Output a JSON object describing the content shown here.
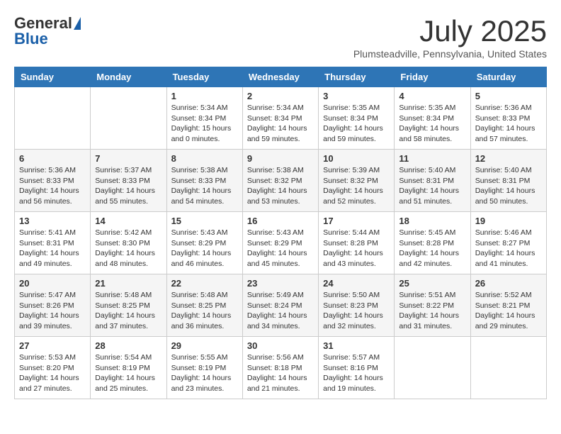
{
  "header": {
    "logo_general": "General",
    "logo_blue": "Blue",
    "month_title": "July 2025",
    "location": "Plumsteadville, Pennsylvania, United States"
  },
  "days_of_week": [
    "Sunday",
    "Monday",
    "Tuesday",
    "Wednesday",
    "Thursday",
    "Friday",
    "Saturday"
  ],
  "weeks": [
    [
      {
        "day": "",
        "info": ""
      },
      {
        "day": "",
        "info": ""
      },
      {
        "day": "1",
        "info": "Sunrise: 5:34 AM\nSunset: 8:34 PM\nDaylight: 15 hours\nand 0 minutes."
      },
      {
        "day": "2",
        "info": "Sunrise: 5:34 AM\nSunset: 8:34 PM\nDaylight: 14 hours\nand 59 minutes."
      },
      {
        "day": "3",
        "info": "Sunrise: 5:35 AM\nSunset: 8:34 PM\nDaylight: 14 hours\nand 59 minutes."
      },
      {
        "day": "4",
        "info": "Sunrise: 5:35 AM\nSunset: 8:34 PM\nDaylight: 14 hours\nand 58 minutes."
      },
      {
        "day": "5",
        "info": "Sunrise: 5:36 AM\nSunset: 8:33 PM\nDaylight: 14 hours\nand 57 minutes."
      }
    ],
    [
      {
        "day": "6",
        "info": "Sunrise: 5:36 AM\nSunset: 8:33 PM\nDaylight: 14 hours\nand 56 minutes."
      },
      {
        "day": "7",
        "info": "Sunrise: 5:37 AM\nSunset: 8:33 PM\nDaylight: 14 hours\nand 55 minutes."
      },
      {
        "day": "8",
        "info": "Sunrise: 5:38 AM\nSunset: 8:33 PM\nDaylight: 14 hours\nand 54 minutes."
      },
      {
        "day": "9",
        "info": "Sunrise: 5:38 AM\nSunset: 8:32 PM\nDaylight: 14 hours\nand 53 minutes."
      },
      {
        "day": "10",
        "info": "Sunrise: 5:39 AM\nSunset: 8:32 PM\nDaylight: 14 hours\nand 52 minutes."
      },
      {
        "day": "11",
        "info": "Sunrise: 5:40 AM\nSunset: 8:31 PM\nDaylight: 14 hours\nand 51 minutes."
      },
      {
        "day": "12",
        "info": "Sunrise: 5:40 AM\nSunset: 8:31 PM\nDaylight: 14 hours\nand 50 minutes."
      }
    ],
    [
      {
        "day": "13",
        "info": "Sunrise: 5:41 AM\nSunset: 8:31 PM\nDaylight: 14 hours\nand 49 minutes."
      },
      {
        "day": "14",
        "info": "Sunrise: 5:42 AM\nSunset: 8:30 PM\nDaylight: 14 hours\nand 48 minutes."
      },
      {
        "day": "15",
        "info": "Sunrise: 5:43 AM\nSunset: 8:29 PM\nDaylight: 14 hours\nand 46 minutes."
      },
      {
        "day": "16",
        "info": "Sunrise: 5:43 AM\nSunset: 8:29 PM\nDaylight: 14 hours\nand 45 minutes."
      },
      {
        "day": "17",
        "info": "Sunrise: 5:44 AM\nSunset: 8:28 PM\nDaylight: 14 hours\nand 43 minutes."
      },
      {
        "day": "18",
        "info": "Sunrise: 5:45 AM\nSunset: 8:28 PM\nDaylight: 14 hours\nand 42 minutes."
      },
      {
        "day": "19",
        "info": "Sunrise: 5:46 AM\nSunset: 8:27 PM\nDaylight: 14 hours\nand 41 minutes."
      }
    ],
    [
      {
        "day": "20",
        "info": "Sunrise: 5:47 AM\nSunset: 8:26 PM\nDaylight: 14 hours\nand 39 minutes."
      },
      {
        "day": "21",
        "info": "Sunrise: 5:48 AM\nSunset: 8:25 PM\nDaylight: 14 hours\nand 37 minutes."
      },
      {
        "day": "22",
        "info": "Sunrise: 5:48 AM\nSunset: 8:25 PM\nDaylight: 14 hours\nand 36 minutes."
      },
      {
        "day": "23",
        "info": "Sunrise: 5:49 AM\nSunset: 8:24 PM\nDaylight: 14 hours\nand 34 minutes."
      },
      {
        "day": "24",
        "info": "Sunrise: 5:50 AM\nSunset: 8:23 PM\nDaylight: 14 hours\nand 32 minutes."
      },
      {
        "day": "25",
        "info": "Sunrise: 5:51 AM\nSunset: 8:22 PM\nDaylight: 14 hours\nand 31 minutes."
      },
      {
        "day": "26",
        "info": "Sunrise: 5:52 AM\nSunset: 8:21 PM\nDaylight: 14 hours\nand 29 minutes."
      }
    ],
    [
      {
        "day": "27",
        "info": "Sunrise: 5:53 AM\nSunset: 8:20 PM\nDaylight: 14 hours\nand 27 minutes."
      },
      {
        "day": "28",
        "info": "Sunrise: 5:54 AM\nSunset: 8:19 PM\nDaylight: 14 hours\nand 25 minutes."
      },
      {
        "day": "29",
        "info": "Sunrise: 5:55 AM\nSunset: 8:19 PM\nDaylight: 14 hours\nand 23 minutes."
      },
      {
        "day": "30",
        "info": "Sunrise: 5:56 AM\nSunset: 8:18 PM\nDaylight: 14 hours\nand 21 minutes."
      },
      {
        "day": "31",
        "info": "Sunrise: 5:57 AM\nSunset: 8:16 PM\nDaylight: 14 hours\nand 19 minutes."
      },
      {
        "day": "",
        "info": ""
      },
      {
        "day": "",
        "info": ""
      }
    ]
  ]
}
